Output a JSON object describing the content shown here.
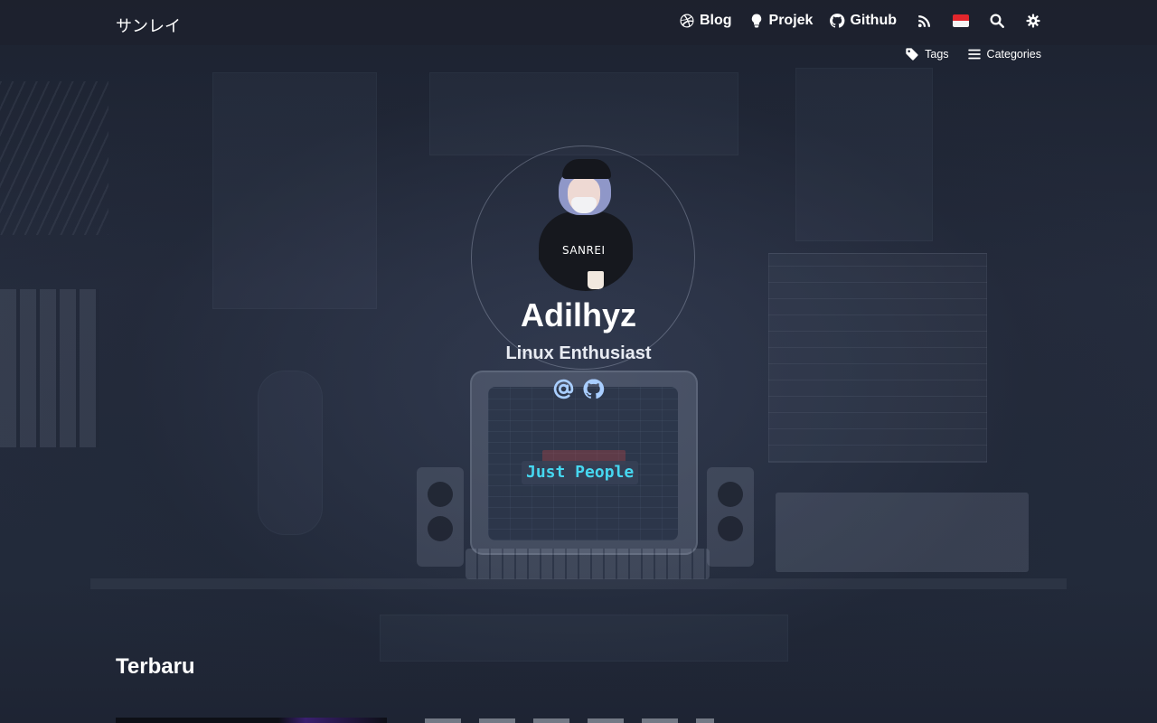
{
  "site": {
    "brand": "サンレイ"
  },
  "nav": {
    "items": [
      {
        "label": "Blog",
        "icon": "dribbble-icon"
      },
      {
        "label": "Projek",
        "icon": "lightbulb-icon"
      },
      {
        "label": "Github",
        "icon": "github-icon"
      }
    ],
    "rss_icon": "rss-icon",
    "language_icon": "indonesia-flag-icon",
    "search_icon": "search-icon",
    "theme_icon": "gear-icon"
  },
  "subnav": {
    "tags_label": "Tags",
    "categories_label": "Categories"
  },
  "profile": {
    "avatar_text": "SANREI",
    "name": "Adilhyz",
    "subtitle": "Linux Enthusiast",
    "socials": [
      "email-icon",
      "github-icon"
    ],
    "code_text": "Just People"
  },
  "sections": {
    "latest_title": "Terbaru"
  },
  "colors": {
    "background": "#1e2433",
    "code_accent": "#46d7f0",
    "text": "#ffffff"
  }
}
